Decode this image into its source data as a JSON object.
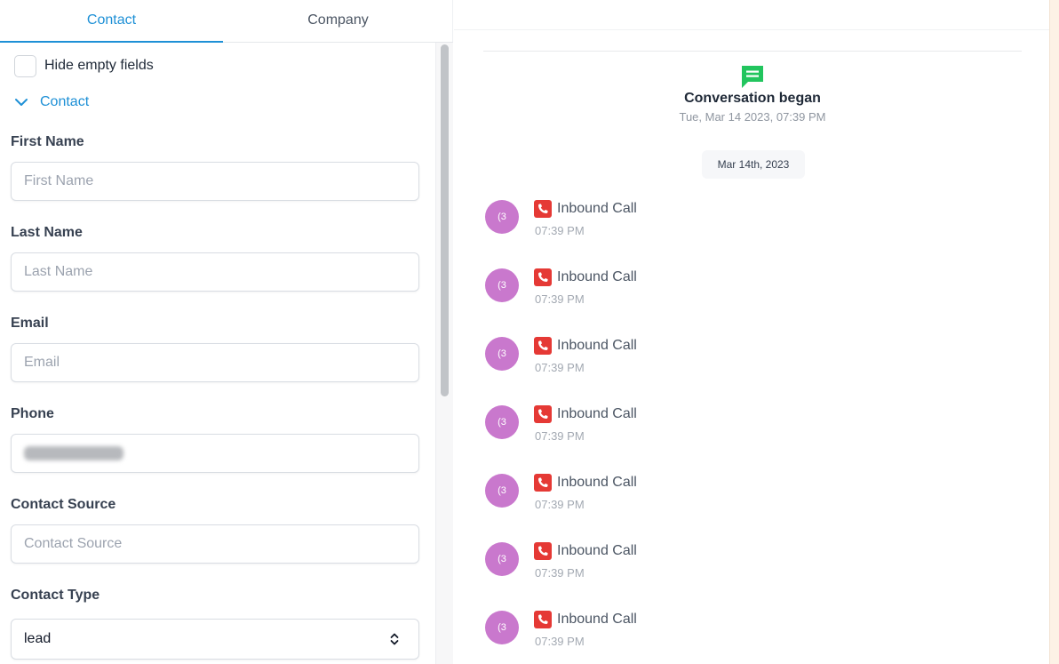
{
  "tabs": {
    "contact": "Contact",
    "company": "Company"
  },
  "hide_empty": {
    "label": "Hide empty fields",
    "checked": false
  },
  "section": {
    "label": "Contact"
  },
  "fields": {
    "first_name": {
      "label": "First Name",
      "placeholder": "First Name"
    },
    "last_name": {
      "label": "Last Name",
      "placeholder": "Last Name"
    },
    "email": {
      "label": "Email",
      "placeholder": "Email"
    },
    "phone": {
      "label": "Phone",
      "value": "(redacted)"
    },
    "contact_source": {
      "label": "Contact Source",
      "placeholder": "Contact Source"
    },
    "contact_type": {
      "label": "Contact Type",
      "value": "lead"
    }
  },
  "conversation": {
    "title": "Conversation began",
    "timestamp": "Tue, Mar 14 2023, 07:39 PM",
    "date_divider": "Mar 14th, 2023",
    "messages": [
      {
        "avatar": "(3",
        "label": "Inbound Call",
        "time": "07:39 PM"
      },
      {
        "avatar": "(3",
        "label": "Inbound Call",
        "time": "07:39 PM"
      },
      {
        "avatar": "(3",
        "label": "Inbound Call",
        "time": "07:39 PM"
      },
      {
        "avatar": "(3",
        "label": "Inbound Call",
        "time": "07:39 PM"
      },
      {
        "avatar": "(3",
        "label": "Inbound Call",
        "time": "07:39 PM"
      },
      {
        "avatar": "(3",
        "label": "Inbound Call",
        "time": "07:39 PM"
      },
      {
        "avatar": "(3",
        "label": "Inbound Call",
        "time": "07:39 PM"
      }
    ]
  },
  "colors": {
    "accent": "#1e90d6",
    "avatar": "#c978cd",
    "call_icon": "#e53935",
    "conversation_icon": "#22c55e"
  },
  "icons": {
    "chevron": "chevron-down-icon",
    "conversation": "chat-bubble-icon",
    "call": "phone-icon",
    "select": "up-down-arrows-icon"
  }
}
